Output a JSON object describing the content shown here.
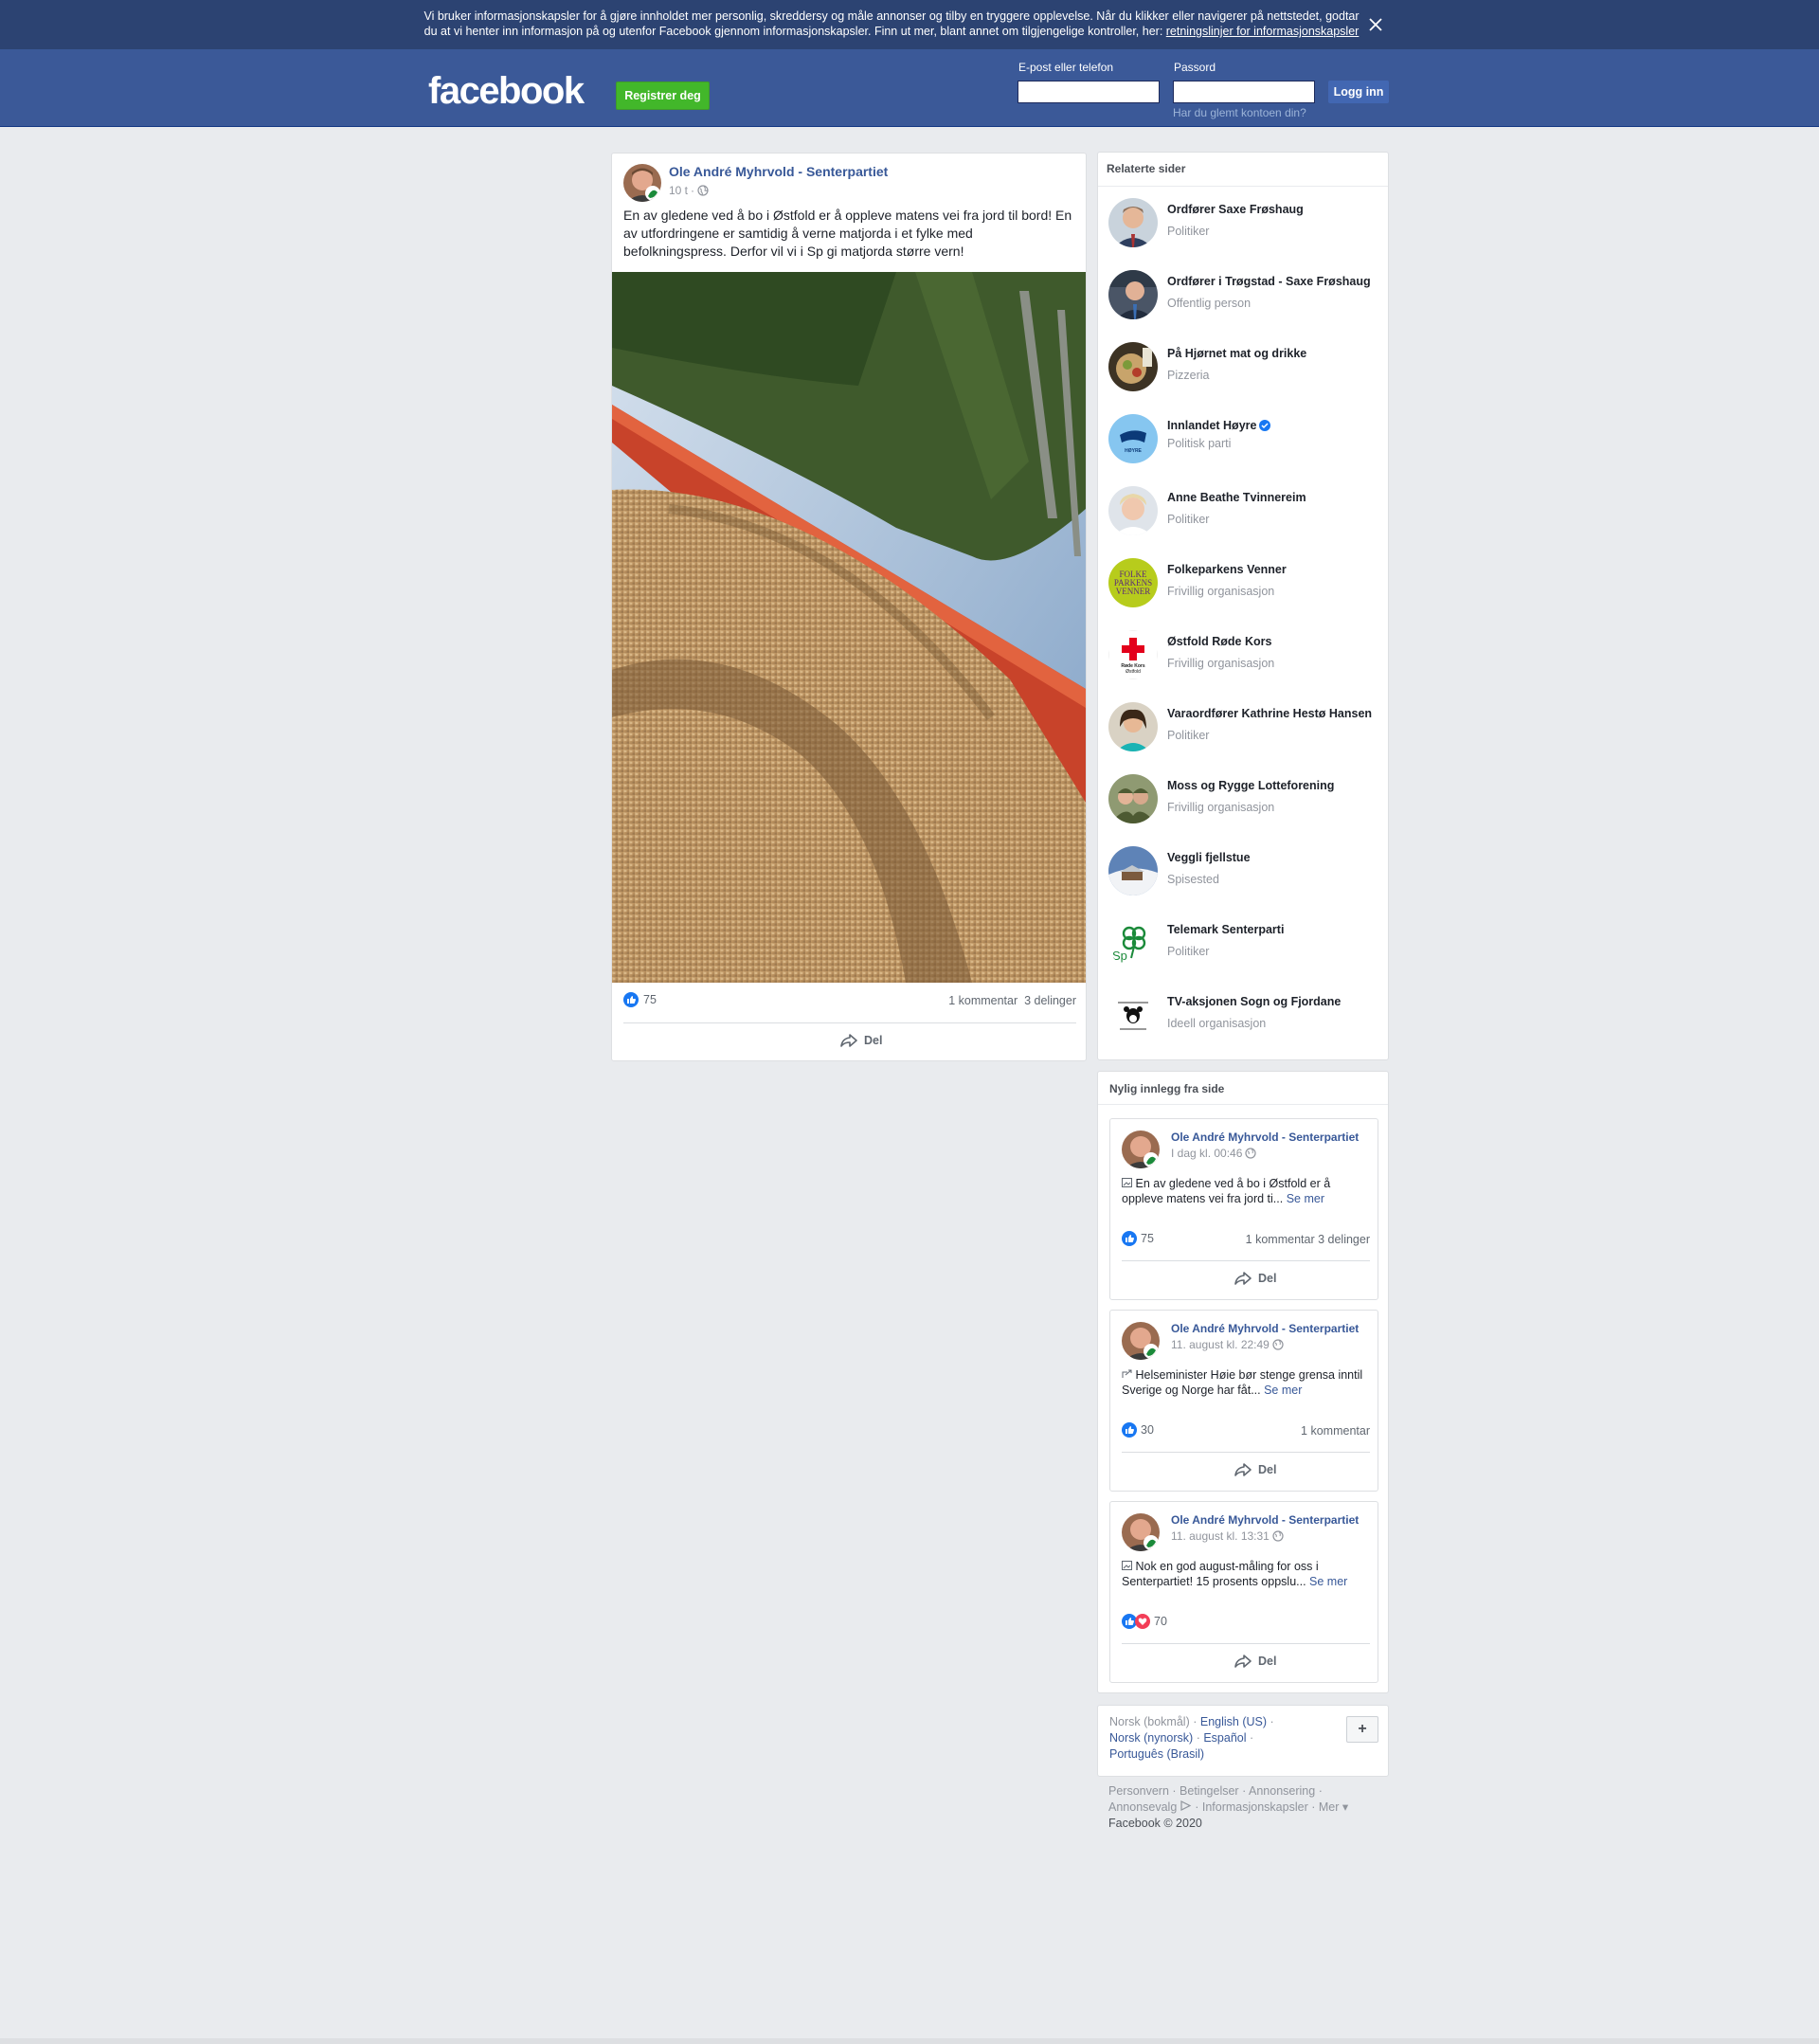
{
  "cookie_banner": {
    "text": "Vi bruker informasjonskapsler for å gjøre innholdet mer personlig, skreddersy og måle annonser og tilby en tryggere opplevelse. Når du klikker eller navigerer på nettstedet, godtar du at vi henter inn informasjon på og utenfor Facebook gjennom informasjonskapsler. Finn ut mer, blant annet om tilgjengelige kontroller, her: ",
    "link": "retningslinjer for informasjonskapsler"
  },
  "header": {
    "logo": "facebook",
    "register": "Registrer deg",
    "email_label": "E-post eller telefon",
    "password_label": "Passord",
    "login": "Logg inn",
    "forgot": "Har du glemt kontoen din?"
  },
  "post": {
    "author": "Ole André Myhrvold - Senterpartiet",
    "time": "10 t",
    "text": "En av gledene ved å bo i Østfold er å oppleve matens vei fra jord til bord! En av utfordringene er samtidig å verne matjorda i et fylke med befolkningspress. Derfor vil vi i Sp gi matjorda større vern!",
    "likes": "75",
    "comments": "1 kommentar",
    "shares": "3 delinger",
    "share_label": "Del"
  },
  "related": {
    "title": "Relaterte sider",
    "items": [
      {
        "name": "Ordfører Saxe Frøshaug",
        "category": "Politiker"
      },
      {
        "name": "Ordfører i Trøgstad - Saxe Frøshaug",
        "category": "Offentlig person"
      },
      {
        "name": "På Hjørnet mat og drikke",
        "category": "Pizzeria"
      },
      {
        "name": "Innlandet Høyre",
        "category": "Politisk parti"
      },
      {
        "name": "Anne Beathe Tvinnereim",
        "category": "Politiker"
      },
      {
        "name": "Folkeparkens Venner",
        "category": "Frivillig organisasjon"
      },
      {
        "name": "Østfold Røde Kors",
        "category": "Frivillig organisasjon"
      },
      {
        "name": "Varaordfører Kathrine Hestø Hansen",
        "category": "Politiker"
      },
      {
        "name": "Moss og Rygge Lotteforening",
        "category": "Frivillig organisasjon"
      },
      {
        "name": "Veggli fjellstue",
        "category": "Spisested"
      },
      {
        "name": "Telemark Senterparti",
        "category": "Politiker"
      },
      {
        "name": "TV-aksjonen Sogn og Fjordane",
        "category": "Ideell organisasjon"
      }
    ],
    "logo_texts": {
      "hoyre": "HØYRE",
      "folkeparken": [
        "FOLKE",
        "PARKENS",
        "VENNER"
      ],
      "rodekors": [
        "Røde Kors",
        "Østfold"
      ],
      "sp": "Sp"
    }
  },
  "recent": {
    "title": "Nylig innlegg fra side",
    "posts": [
      {
        "author": "Ole André Myhrvold - Senterpartiet",
        "date": "I dag kl. 00:46",
        "text": "En av gledene ved å bo i Østfold er å oppleve matens vei fra jord ti...",
        "see_more": "Se mer",
        "likes": "75",
        "right": "1 kommentar  3 delinger",
        "share": "Del"
      },
      {
        "author": "Ole André Myhrvold - Senterpartiet",
        "date": "11. august kl. 22:49",
        "text": "Helseminister Høie bør stenge grensa inntil Sverige og Norge har fåt...",
        "see_more": "Se mer",
        "likes": "30",
        "right": "1 kommentar",
        "share": "Del"
      },
      {
        "author": "Ole André Myhrvold - Senterpartiet",
        "date": "11. august kl. 13:31",
        "text": "Nok en god august-måling for oss i Senterpartiet! 15 prosents oppslu...",
        "see_more": "Se mer",
        "likes": "70",
        "right": "",
        "share": "Del"
      }
    ]
  },
  "languages": {
    "current": "Norsk (bokmål)",
    "english": "English (US)",
    "nynorsk": "Norsk (nynorsk)",
    "espanol": "Español",
    "portugues": "Português (Brasil)",
    "plus": "+"
  },
  "footer": {
    "privacy": "Personvern",
    "terms": "Betingelser",
    "ads": "Annonsering",
    "ad_choices": "Annonsevalg",
    "cookies": "Informasjonskapsler",
    "more": "Mer",
    "copyright": "Facebook © 2020"
  },
  "colors": {
    "brand": "#3b5998",
    "banner": "#2c4372",
    "link": "#385898",
    "green": "#42b72a"
  }
}
